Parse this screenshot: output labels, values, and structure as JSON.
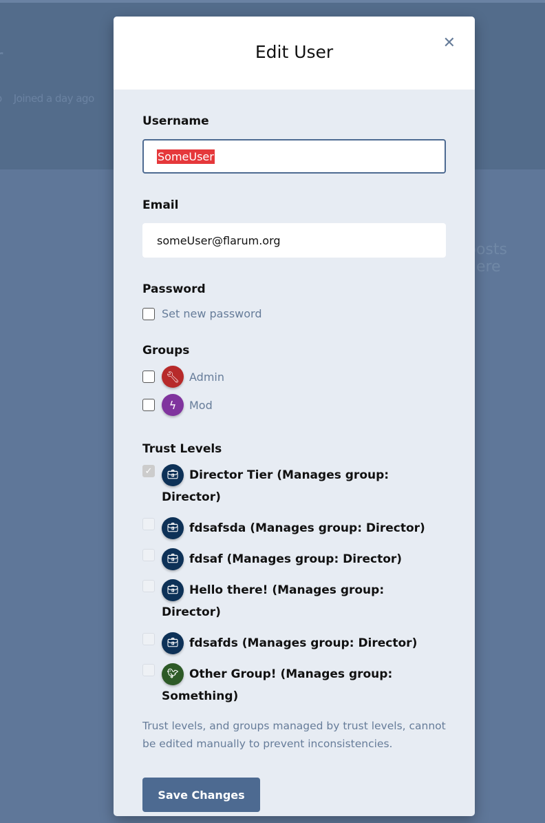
{
  "background": {
    "name_fragment": "r",
    "joined": "o    Joined a day ago",
    "posts": "posts here"
  },
  "modal": {
    "title": "Edit User",
    "close_icon": "times-icon",
    "username": {
      "label": "Username",
      "value": "SomeUser"
    },
    "email": {
      "label": "Email",
      "value": "someUser@flarum.org"
    },
    "password": {
      "label": "Password",
      "option": "Set new password",
      "checked": false
    },
    "groups": {
      "label": "Groups",
      "items": [
        {
          "label": "Admin",
          "icon": "wrench-icon",
          "color": "#b72a2a",
          "checked": false
        },
        {
          "label": "Mod",
          "icon": "bolt-icon",
          "color": "#80349e",
          "checked": false
        }
      ]
    },
    "trust_levels": {
      "label": "Trust Levels",
      "items": [
        {
          "label": "Director Tier (Manages group: Director)",
          "icon": "briefcase-icon",
          "color": "#0d3157",
          "checked": true
        },
        {
          "label": "fdsafsda (Manages group: Director)",
          "icon": "briefcase-icon",
          "color": "#0d3157",
          "checked": false
        },
        {
          "label": "fdsaf (Manages group: Director)",
          "icon": "briefcase-icon",
          "color": "#0d3157",
          "checked": false
        },
        {
          "label": "Hello there! (Manages group: Director)",
          "icon": "briefcase-icon",
          "color": "#0d3157",
          "checked": false
        },
        {
          "label": "fdsafds (Manages group: Director)",
          "icon": "briefcase-icon",
          "color": "#0d3157",
          "checked": false
        },
        {
          "label": "Other Group! (Manages group: Something)",
          "icon": "crow-icon",
          "color": "#2d5a27",
          "checked": false
        }
      ],
      "help": "Trust levels, and groups managed by trust levels, cannot be edited manually to prevent inconsistencies."
    },
    "save_label": "Save Changes"
  }
}
